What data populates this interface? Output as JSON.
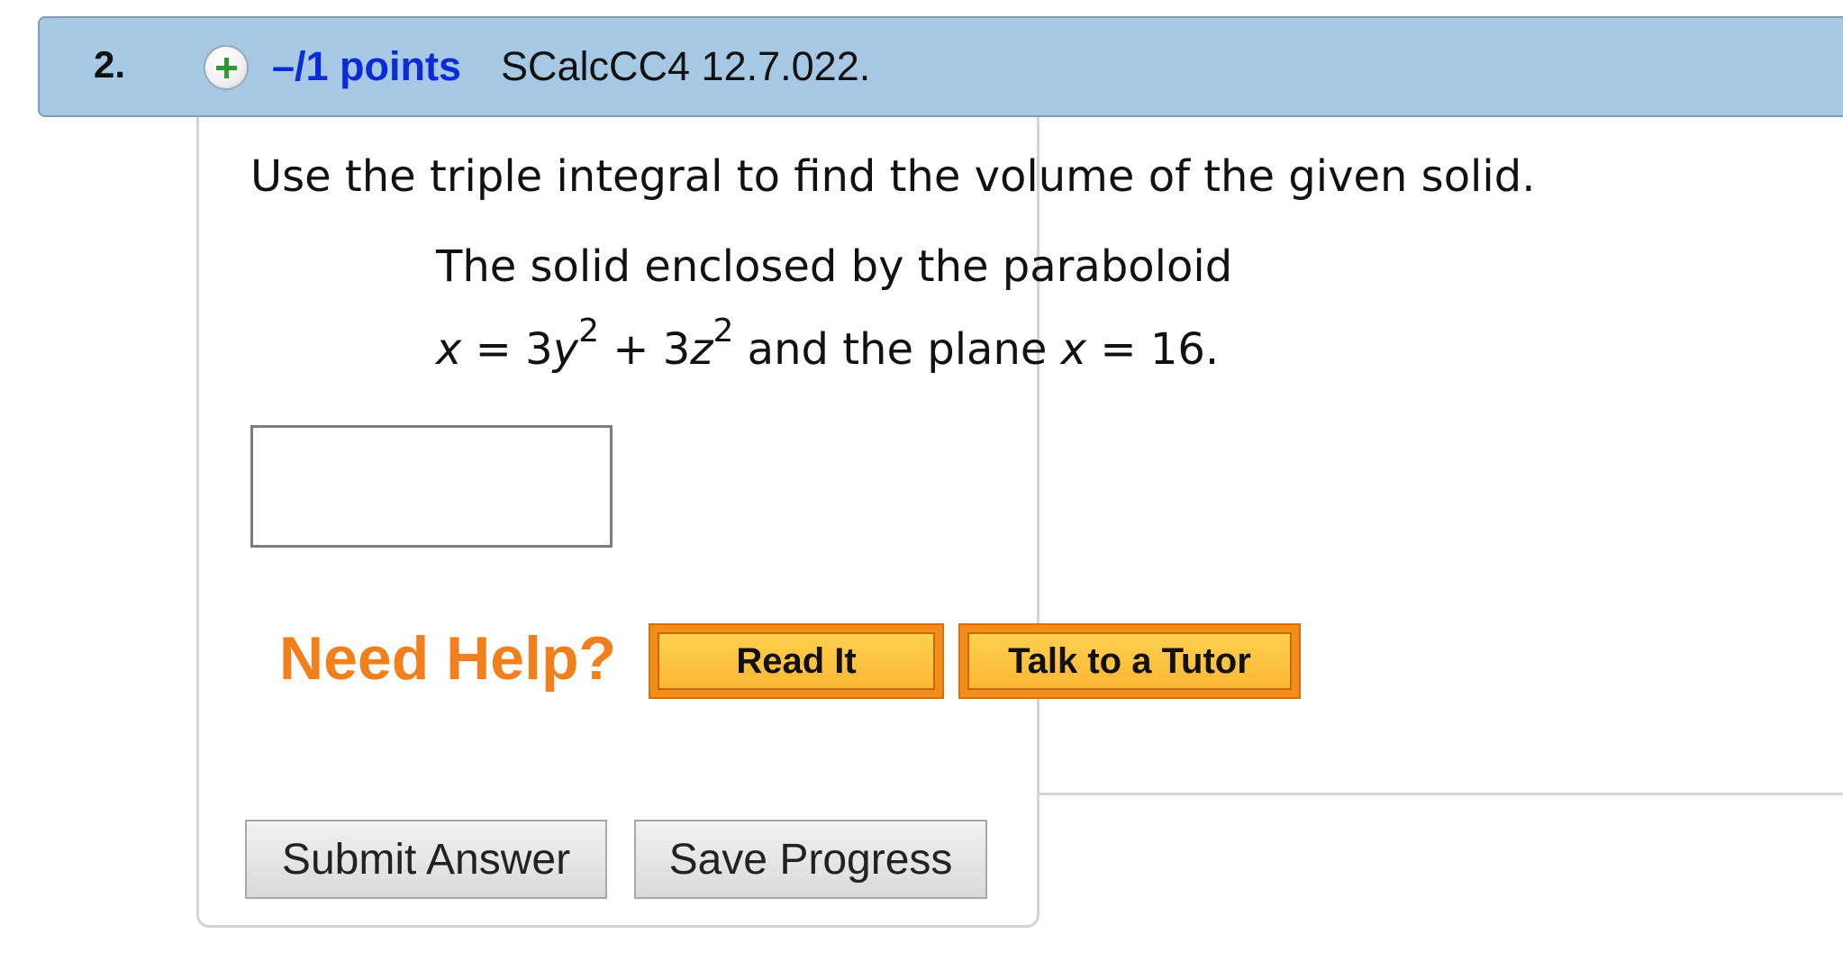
{
  "question": {
    "number": "2.",
    "points_label": "–/1 points",
    "problem_code": "SCalcCC4 12.7.022."
  },
  "prompt": "Use the triple integral to find the volume of the given solid.",
  "statement": {
    "line1": "The solid enclosed by the paraboloid",
    "line2": {
      "var1": "x",
      "eq1": " = 3",
      "var2": "y",
      "exp1": "2",
      "plus": " + 3",
      "var3": "z",
      "exp2": "2",
      "mid": " and the plane ",
      "var4": "x",
      "end": " = 16."
    }
  },
  "answer_input": {
    "value": "",
    "placeholder": ""
  },
  "help": {
    "label": "Need Help?",
    "read_it": "Read It",
    "talk_to_tutor": "Talk to a Tutor"
  },
  "actions": {
    "submit": "Submit Answer",
    "save": "Save Progress"
  },
  "colors": {
    "header_bg": "#a6c8e4",
    "points_link": "#0a2bd6",
    "need_help": "#f07f1c",
    "help_button": "#fbb733"
  },
  "icons": {
    "expand": "plus-circle-icon"
  }
}
